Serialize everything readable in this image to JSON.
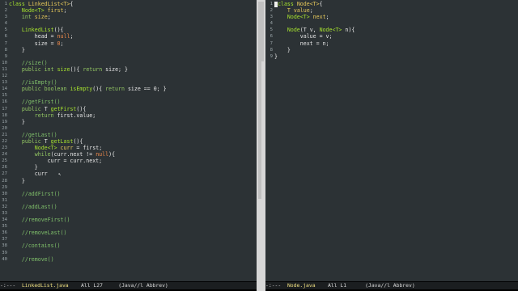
{
  "left_buffer": {
    "lines": [
      [
        [
          "t",
          "class "
        ],
        [
          "ty",
          "LinkedList<T>"
        ],
        [
          "p",
          "{"
        ]
      ],
      [
        [
          "p",
          "    "
        ],
        [
          "t",
          "Node<T>"
        ],
        [
          "p",
          " "
        ],
        [
          "f",
          "first"
        ],
        [
          "p",
          ";"
        ]
      ],
      [
        [
          "p",
          "    "
        ],
        [
          "k",
          "int"
        ],
        [
          "p",
          " "
        ],
        [
          "f",
          "size"
        ],
        [
          "p",
          ";"
        ]
      ],
      [
        [
          "p",
          ""
        ]
      ],
      [
        [
          "p",
          "    "
        ],
        [
          "t",
          "LinkedList"
        ],
        [
          "p",
          "(){"
        ]
      ],
      [
        [
          "p",
          "        head = "
        ],
        [
          "n",
          "null"
        ],
        [
          "p",
          ";"
        ]
      ],
      [
        [
          "p",
          "        size = "
        ],
        [
          "n",
          "0"
        ],
        [
          "p",
          ";"
        ]
      ],
      [
        [
          "p",
          "    }"
        ]
      ],
      [
        [
          "p",
          ""
        ]
      ],
      [
        [
          "p",
          "    "
        ],
        [
          "c",
          "//size()"
        ]
      ],
      [
        [
          "p",
          "    "
        ],
        [
          "k",
          "public int"
        ],
        [
          "p",
          " "
        ],
        [
          "t",
          "size"
        ],
        [
          "p",
          "(){ "
        ],
        [
          "k",
          "return"
        ],
        [
          "p",
          " size; }"
        ]
      ],
      [
        [
          "p",
          ""
        ]
      ],
      [
        [
          "p",
          "    "
        ],
        [
          "c",
          "//isEmpty()"
        ]
      ],
      [
        [
          "p",
          "    "
        ],
        [
          "k",
          "public boolean"
        ],
        [
          "p",
          " "
        ],
        [
          "t",
          "isEmpty"
        ],
        [
          "p",
          "(){ "
        ],
        [
          "k",
          "return"
        ],
        [
          "p",
          " size == 0; }"
        ]
      ],
      [
        [
          "p",
          ""
        ]
      ],
      [
        [
          "p",
          "    "
        ],
        [
          "c",
          "//getFirst()"
        ]
      ],
      [
        [
          "p",
          "    "
        ],
        [
          "k",
          "public"
        ],
        [
          "p",
          " T "
        ],
        [
          "t",
          "getFirst"
        ],
        [
          "p",
          "(){"
        ]
      ],
      [
        [
          "p",
          "        "
        ],
        [
          "k",
          "return"
        ],
        [
          "p",
          " first.value;"
        ]
      ],
      [
        [
          "p",
          "    }"
        ]
      ],
      [
        [
          "p",
          ""
        ]
      ],
      [
        [
          "p",
          "    "
        ],
        [
          "c",
          "//getLast()"
        ]
      ],
      [
        [
          "p",
          "    "
        ],
        [
          "k",
          "public"
        ],
        [
          "p",
          " T "
        ],
        [
          "t",
          "getLast"
        ],
        [
          "p",
          "(){"
        ]
      ],
      [
        [
          "p",
          "        "
        ],
        [
          "t",
          "Node<T>"
        ],
        [
          "p",
          " "
        ],
        [
          "f",
          "curr"
        ],
        [
          "p",
          " = first;"
        ]
      ],
      [
        [
          "p",
          "        "
        ],
        [
          "k",
          "while"
        ],
        [
          "p",
          "(curr.next != "
        ],
        [
          "n",
          "null"
        ],
        [
          "p",
          "){"
        ]
      ],
      [
        [
          "p",
          "            curr = curr.next;"
        ]
      ],
      [
        [
          "p",
          "        }"
        ]
      ],
      [
        [
          "p",
          "        curr"
        ]
      ],
      [
        [
          "p",
          "    }"
        ]
      ],
      [
        [
          "p",
          ""
        ]
      ],
      [
        [
          "p",
          "    "
        ],
        [
          "c",
          "//addFirst()"
        ]
      ],
      [
        [
          "p",
          ""
        ]
      ],
      [
        [
          "p",
          "    "
        ],
        [
          "c",
          "//addLast()"
        ]
      ],
      [
        [
          "p",
          ""
        ]
      ],
      [
        [
          "p",
          "    "
        ],
        [
          "c",
          "//removeFirst()"
        ]
      ],
      [
        [
          "p",
          ""
        ]
      ],
      [
        [
          "p",
          "    "
        ],
        [
          "c",
          "//removeLast()"
        ]
      ],
      [
        [
          "p",
          ""
        ]
      ],
      [
        [
          "p",
          "    "
        ],
        [
          "c",
          "//contains()"
        ]
      ],
      [
        [
          "p",
          ""
        ]
      ],
      [
        [
          "p",
          "    "
        ],
        [
          "c",
          "//remove()"
        ]
      ]
    ],
    "line_numbers": [
      "1",
      "2",
      "3",
      "4",
      "5",
      "6",
      "7",
      "8",
      "9",
      "10",
      "11",
      "12",
      "13",
      "14",
      "15",
      "16",
      "17",
      "18",
      "19",
      "20",
      "21",
      "22",
      "23",
      "24",
      "25",
      "26",
      "27",
      "28",
      "29",
      "30",
      "31",
      "32",
      "33",
      "34",
      "35",
      "36",
      "37",
      "38",
      "39",
      "40"
    ]
  },
  "right_buffer": {
    "lines": [
      [
        [
          "t",
          "class "
        ],
        [
          "ty",
          "Node<T>"
        ],
        [
          "p",
          "{"
        ]
      ],
      [
        [
          "p",
          "    "
        ],
        [
          "ty",
          "T"
        ],
        [
          "p",
          " "
        ],
        [
          "f",
          "value"
        ],
        [
          "p",
          ";"
        ]
      ],
      [
        [
          "p",
          "    "
        ],
        [
          "t",
          "Node<T>"
        ],
        [
          "p",
          " "
        ],
        [
          "f",
          "next"
        ],
        [
          "p",
          ";"
        ]
      ],
      [
        [
          "p",
          ""
        ]
      ],
      [
        [
          "p",
          "    "
        ],
        [
          "t",
          "Node"
        ],
        [
          "p",
          "(T v, "
        ],
        [
          "t",
          "Node<T>"
        ],
        [
          "p",
          " n){"
        ]
      ],
      [
        [
          "p",
          "        value = v;"
        ]
      ],
      [
        [
          "p",
          "        next = n;"
        ]
      ],
      [
        [
          "p",
          "    }"
        ]
      ],
      [
        [
          "p",
          "}"
        ]
      ]
    ],
    "line_numbers": [
      "1",
      "2",
      "3",
      "4",
      "5",
      "6",
      "7",
      "8",
      "9"
    ]
  },
  "left_modeline": {
    "prefix": "-:---  ",
    "buffer_name": "LinkedList.java",
    "position": "    All L27     ",
    "mode": "(Java//l Abbrev)"
  },
  "right_modeline": {
    "prefix": "-:---  ",
    "buffer_name": "Node.java",
    "position": "    All L1      ",
    "mode": "(Java//l Abbrev)"
  }
}
